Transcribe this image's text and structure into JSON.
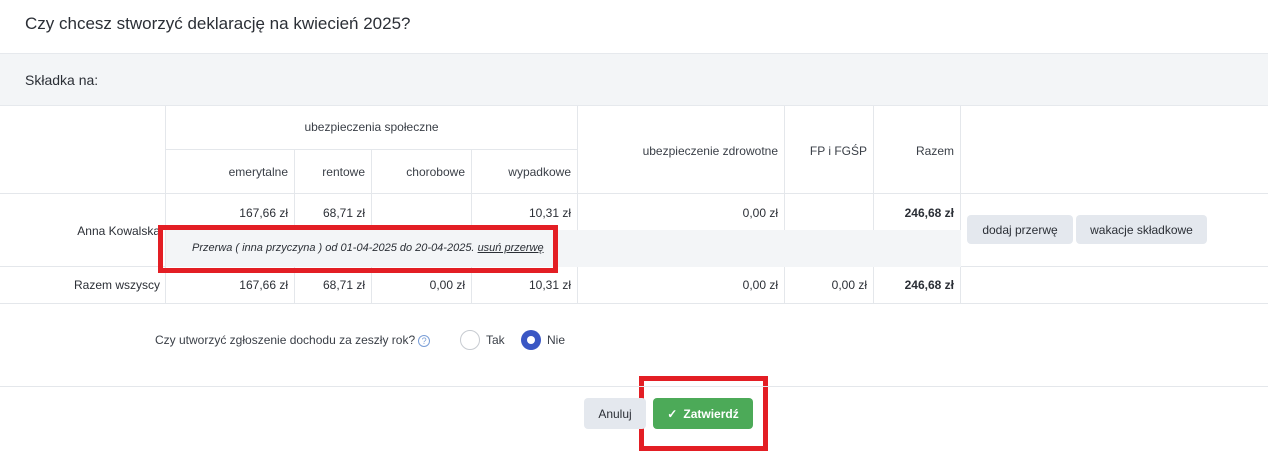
{
  "dialog": {
    "title": "Czy chcesz stworzyć deklarację na kwiecień 2025?",
    "section_label": "Składka na:"
  },
  "table": {
    "group_header": "ubezpieczenia społeczne",
    "headers": {
      "emerytalne": "emerytalne",
      "rentowe": "rentowe",
      "chorobowe": "chorobowe",
      "wypadkowe": "wypadkowe",
      "zdrowotne": "ubezpieczenie zdrowotne",
      "fp": "FP i FGŚP",
      "razem": "Razem"
    },
    "person_row": {
      "name": "Anna Kowalska",
      "emerytalne": "167,66 zł",
      "rentowe": "68,71 zł",
      "chorobowe": "",
      "wypadkowe": "10,31 zł",
      "zdrowotne": "0,00 zł",
      "fp": "",
      "razem": "246,68 zł",
      "break_text": "Przerwa ( inna przyczyna ) od 01-04-2025 do 20-04-2025.",
      "remove_break_link": "usuń przerwę",
      "add_break_button": "dodaj przerwę",
      "vacation_button": "wakacje składkowe"
    },
    "total_row": {
      "name": "Razem wszyscy",
      "emerytalne": "167,66 zł",
      "rentowe": "68,71 zł",
      "chorobowe": "0,00 zł",
      "wypadkowe": "10,31 zł",
      "zdrowotne": "0,00 zł",
      "fp": "0,00 zł",
      "razem": "246,68 zł"
    }
  },
  "income_question": {
    "label": "Czy utworzyć zgłoszenie dochodu za zeszły rok?",
    "help_icon": "question-circle-icon",
    "options": [
      "Tak",
      "Nie"
    ],
    "selected": "Nie"
  },
  "footer": {
    "cancel_label": "Anuluj",
    "confirm_label": "Zatwierdź",
    "confirm_icon": "check-icon",
    "confirm_color": "#4caa58"
  },
  "highlight_color": "#e31e24"
}
